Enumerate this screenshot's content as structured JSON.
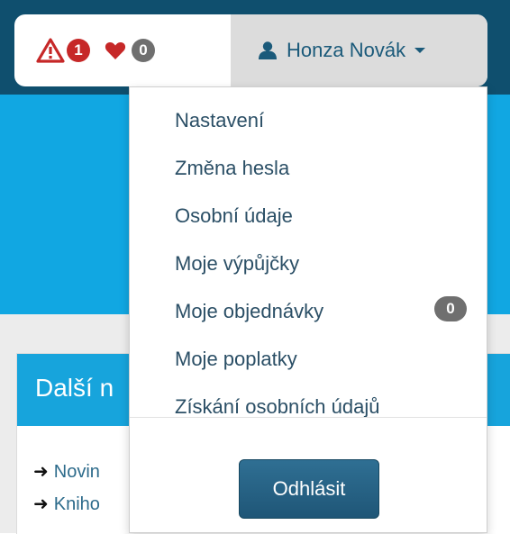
{
  "header": {
    "alerts": {
      "warning_icon": "warning-triangle-icon",
      "warning_count": "1",
      "heart_icon": "heart-icon",
      "favorites_count": "0"
    },
    "user": {
      "icon": "user-icon",
      "name": "Honza Novák"
    }
  },
  "dropdown": {
    "items": [
      {
        "label": "Nastavení"
      },
      {
        "label": "Změna hesla"
      },
      {
        "label": "Osobní údaje"
      },
      {
        "label": "Moje výpůjčky"
      },
      {
        "label": "Moje objednávky",
        "badge": "0"
      },
      {
        "label": "Moje poplatky"
      },
      {
        "label": "Získání osobních údajů"
      }
    ],
    "logout_label": "Odhlásit"
  },
  "panel": {
    "title": "Další n",
    "links": [
      "Novin",
      "Kniho"
    ]
  },
  "colors": {
    "topbar": "#0f4f6e",
    "band": "#11a7e2",
    "warning_red": "#c62828",
    "badge_gray": "#6f6f6f",
    "link": "#2b4f66",
    "button": "#1f5677"
  }
}
